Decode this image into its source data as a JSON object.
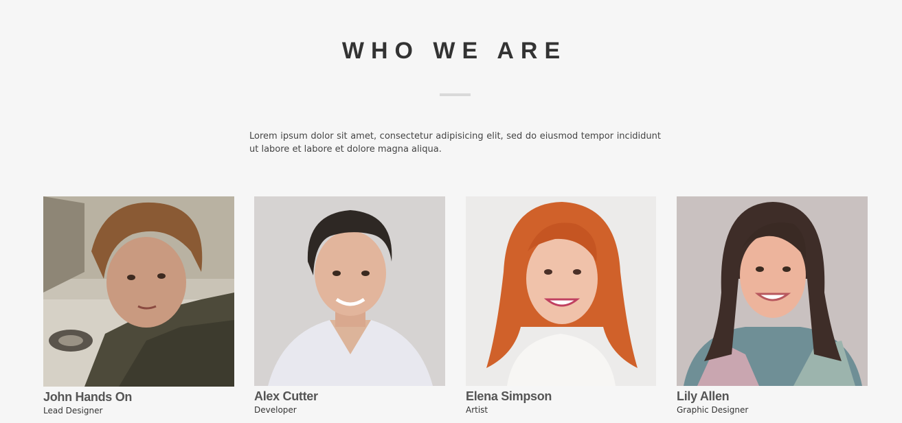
{
  "section": {
    "title": "WHO WE ARE",
    "intro": "Lorem ipsum dolor sit amet, consectetur adipisicing elit, sed do eiusmod tempor incididunt ut labore et labore et dolore magna aliqua."
  },
  "team": [
    {
      "name": "John Hands On",
      "role": "Lead Designer"
    },
    {
      "name": "Alex Cutter",
      "role": "Developer"
    },
    {
      "name": "Elena Simpson",
      "role": "Artist"
    },
    {
      "name": "Lily Allen",
      "role": "Graphic Designer"
    }
  ],
  "colors": {
    "background": "#f6f6f6",
    "title": "#333333",
    "divider": "#d9d9d9",
    "name": "#555555"
  }
}
